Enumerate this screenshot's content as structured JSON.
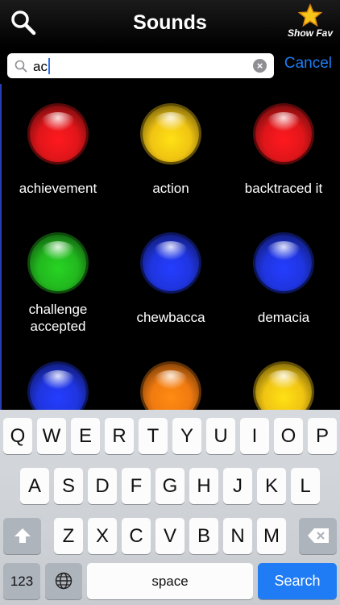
{
  "nav": {
    "title": "Sounds",
    "fav_label": "Show Fav"
  },
  "search": {
    "value": "ac",
    "cancel_label": "Cancel"
  },
  "colors": {
    "accent": "#1f7cf5",
    "red": "#e0161a",
    "yellow": "#f0c412",
    "blue": "#1f35e0",
    "green": "#22b81e",
    "orange": "#f07a10"
  },
  "sounds": [
    {
      "label": "achievement",
      "color": "red"
    },
    {
      "label": "action",
      "color": "yellow"
    },
    {
      "label": "backtraced it",
      "color": "red"
    },
    {
      "label": "challenge accepted",
      "color": "green"
    },
    {
      "label": "chewbacca",
      "color": "blue"
    },
    {
      "label": "demacia",
      "color": "blue"
    },
    {
      "label": "",
      "color": "blue"
    },
    {
      "label": "",
      "color": "orange"
    },
    {
      "label": "",
      "color": "yellow"
    }
  ],
  "keyboard": {
    "row1": [
      "Q",
      "W",
      "E",
      "R",
      "T",
      "Y",
      "U",
      "I",
      "O",
      "P"
    ],
    "row2": [
      "A",
      "S",
      "D",
      "F",
      "G",
      "H",
      "J",
      "K",
      "L"
    ],
    "row3": [
      "Z",
      "X",
      "C",
      "V",
      "B",
      "N",
      "M"
    ],
    "numbers_label": "123",
    "space_label": "space",
    "search_label": "Search"
  }
}
